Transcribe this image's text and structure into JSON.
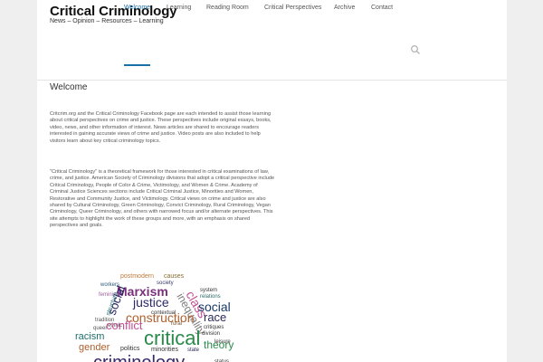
{
  "site": {
    "title": "Critical Criminology",
    "tagline": "News – Opinion – Resources – Learning"
  },
  "nav": {
    "items": [
      {
        "label": "Welcome"
      },
      {
        "label": "Learning"
      },
      {
        "label": "Reading Room"
      },
      {
        "label": "Critical Perspectives"
      },
      {
        "label": "Archive"
      },
      {
        "label": "Contact"
      }
    ],
    "active": "Welcome",
    "search_icon": "search-icon"
  },
  "main": {
    "title": "Welcome",
    "paragraph1": "Critcrim.org and the Critical Criminology Facebook page are each intended to assist those learning about critical perspectives on crime and justice. These perspectives include original essays, books, video, news, and other information of interest. News articles are shared to encourage readers interested in gaining accurate views of crime and justice. Video posts are also included to help visitors learn about key critical criminology topics.",
    "paragraph2": "\"Critical Criminology\" is a theoretical framework for those interested in critical examinations of law, crime, and justice. American Society of Criminology divisions that adopt a critical perspective include Critical Criminology, People of Color & Crime, Victimology, and Women & Crime. Academy of Criminal Justice Sciences sections include Critical Criminal Justice, Minorities and Women, Restorative and Community Justice, and Victimology. Critical views on crime and justice are also shared by Cultural Criminology, Green Criminology, Convict Criminology, Rural Criminology, Vegan Criminology, Queer Criminology, and others with narrowed focus and/or alternate perspectives. This site attempts to highlight the work of these groups and more, with an emphasis on shared perspectives and goals."
  },
  "wordcloud": {
    "words": [
      "causes",
      "postmodern",
      "society",
      "workers",
      "Marxism",
      "class",
      "system",
      "feminism",
      "justice",
      "relations",
      "structure",
      "social",
      "inequality",
      "social",
      "contextual",
      "tradition",
      "construction",
      "race",
      "ethnic",
      "rural",
      "queer",
      "conflict",
      "critiques",
      "racism",
      "critical",
      "division",
      "gender",
      "politics",
      "minorities",
      "state",
      "theory",
      "leisure",
      "criminology",
      "status"
    ]
  },
  "colors": {
    "accent": "#1b6fa8",
    "background": "#efefef",
    "page": "#ffffff"
  }
}
